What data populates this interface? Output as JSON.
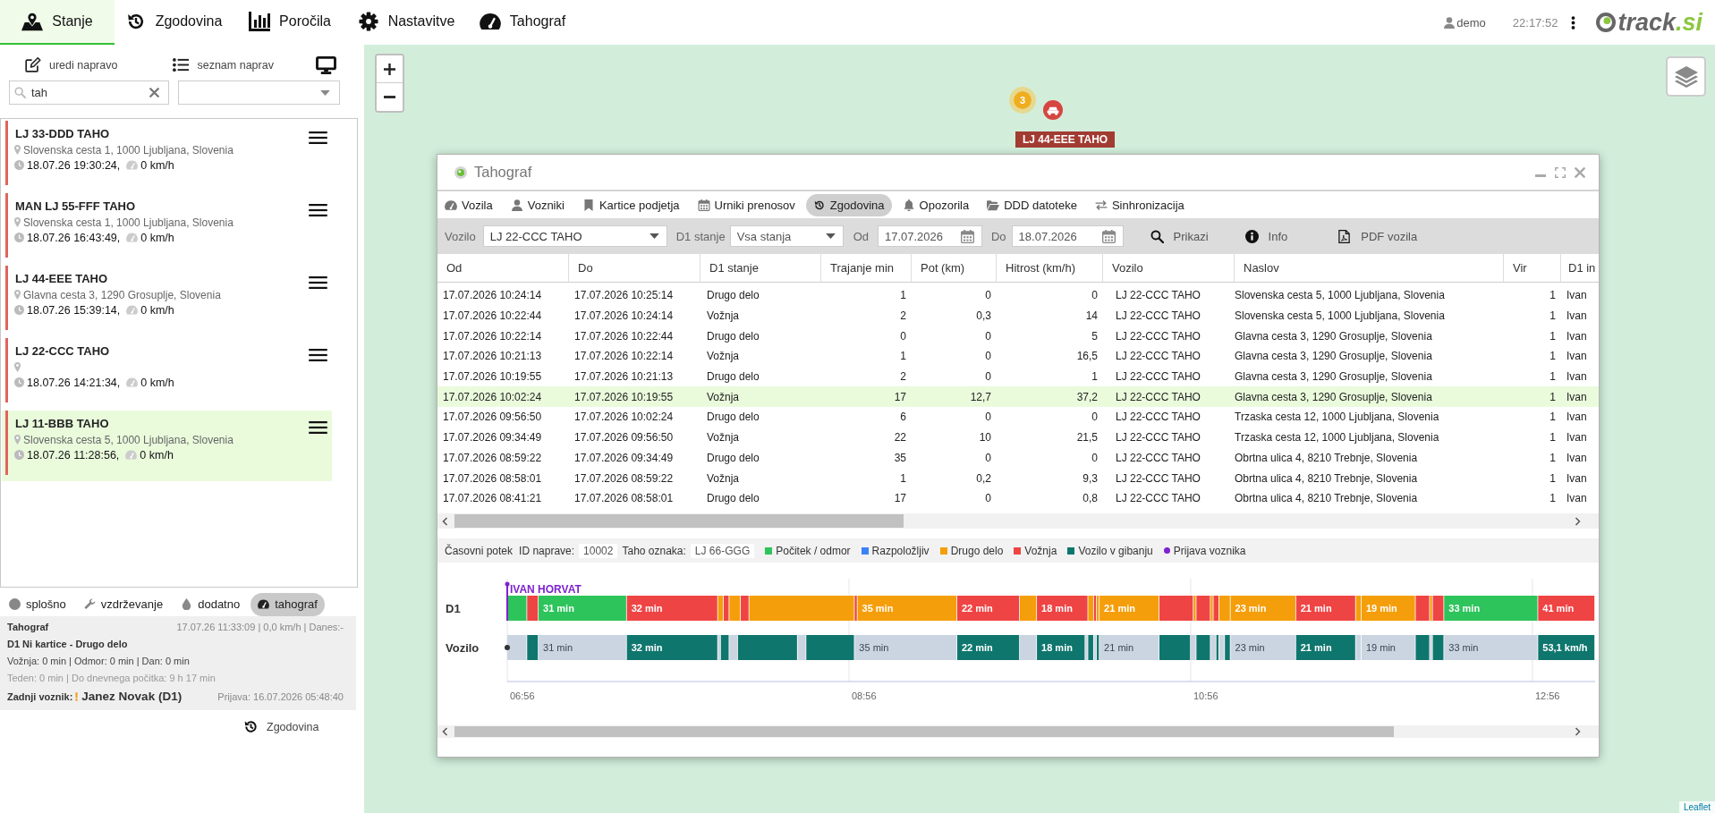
{
  "nav": {
    "tabs": [
      {
        "label": "Stanje",
        "selected": true
      },
      {
        "label": "Zgodovina",
        "selected": false
      },
      {
        "label": "Poročila",
        "selected": false
      },
      {
        "label": "Nastavitve",
        "selected": false
      },
      {
        "label": "Tahograf",
        "selected": false
      }
    ]
  },
  "header": {
    "user": "demo",
    "time": "22:17:52",
    "logo": {
      "text": "track",
      "suffix": ".si"
    }
  },
  "device_panel": {
    "toolbar": [
      "uredi napravo",
      "seznam naprav"
    ],
    "search": {
      "value": "tah"
    },
    "devices": [
      {
        "name": "LJ 33-DDD TAHO",
        "address": "Slovenska cesta 1, 1000 Ljubljana, Slovenia",
        "time": "18.07.26 19:30:24,",
        "speed": "0 km/h",
        "color": "#e0645c",
        "selected": false
      },
      {
        "name": "MAN LJ 55-FFF TAHO",
        "address": "Slovenska cesta 1, 1000 Ljubljana, Slovenia",
        "time": "18.07.26 16:43:49,",
        "speed": "0 km/h",
        "color": "#e0645c",
        "selected": false
      },
      {
        "name": "LJ 44-EEE TAHO",
        "address": "Glavna cesta 3, 1290 Grosuplje, Slovenia",
        "time": "18.07.26 15:39:14,",
        "speed": "0 km/h",
        "color": "#e0645c",
        "selected": false
      },
      {
        "name": "LJ 22-CCC TAHO",
        "time": "18.07.26 14:21:34,",
        "speed": "0 km/h",
        "color": "#e0645c",
        "selected": false
      },
      {
        "name": "LJ 11-BBB TAHO",
        "address": "Slovenska cesta 5, 1000 Ljubljana, Slovenia",
        "time": "18.07.26 11:28:56,",
        "speed": "0 km/h",
        "color": "#e0645c",
        "selected": true
      }
    ],
    "detail_tabs": [
      {
        "label": "splošno",
        "selected": false
      },
      {
        "label": "vzdrževanje",
        "selected": false
      },
      {
        "label": "dodatno",
        "selected": false
      },
      {
        "label": "tahograf",
        "selected": true
      }
    ],
    "tachograph": {
      "title": "Tahograf",
      "status": "17.07.26 11:33:09 | 0,0 km/h | Danes:-",
      "card": "D1 Ni kartice - Drugo delo",
      "driving": "Vožnja: 0 min | Odmor: 0 min | Dan: 0 min",
      "week": "Teden: 0 min | Do dnevnega počitka: 9 h 17 min",
      "last_driver_label": "Zadnji voznik:",
      "last_driver": "Janez Novak (D1)",
      "login": "Prijava: 16.07.2026 05:48:40"
    },
    "history_link": "Zgodovina"
  },
  "map": {
    "cluster_count": "3",
    "vehicle_label": "LJ 44-EEE TAHO",
    "attribution": "Leaflet"
  },
  "dialog": {
    "title": "Tahograf",
    "tabs": [
      {
        "label": "Vozila",
        "selected": false
      },
      {
        "label": "Vozniki",
        "selected": false
      },
      {
        "label": "Kartice podjetja",
        "selected": false
      },
      {
        "label": "Urniki prenosov",
        "selected": false
      },
      {
        "label": "Zgodovina",
        "selected": true
      },
      {
        "label": "Opozorila",
        "selected": false
      },
      {
        "label": "DDD datoteke",
        "selected": false
      },
      {
        "label": "Sinhronizacija",
        "selected": false
      }
    ],
    "filters": {
      "vehicle_label": "Vozilo",
      "vehicle": "LJ 22-CCC TAHO",
      "state_label": "D1 stanje",
      "state": "Vsa stanja",
      "from_label": "Od",
      "from": "17.07.2026",
      "to_label": "Do",
      "to": "18.07.2026"
    },
    "actions": [
      "Prikazi",
      "Info",
      "PDF vozila"
    ],
    "table": {
      "columns": [
        "Od",
        "Do",
        "D1 stanje",
        "Trajanje min",
        "Pot (km)",
        "Hitrost (km/h)",
        "Vozilo",
        "Naslov",
        "Vir",
        "D1 in"
      ],
      "rows": [
        {
          "cells": [
            "17.07.2026 10:24:14",
            "17.07.2026 10:25:14",
            "Drugo delo",
            "1",
            "0",
            "0",
            "LJ 22-CCC TAHO",
            "Slovenska cesta 5, 1000 Ljubljana, Slovenia",
            "1",
            "Ivan"
          ],
          "selected": false
        },
        {
          "cells": [
            "17.07.2026 10:22:44",
            "17.07.2026 10:24:14",
            "Vožnja",
            "2",
            "0,3",
            "14",
            "LJ 22-CCC TAHO",
            "Slovenska cesta 5, 1000 Ljubljana, Slovenia",
            "1",
            "Ivan"
          ],
          "selected": false
        },
        {
          "cells": [
            "17.07.2026 10:22:14",
            "17.07.2026 10:22:44",
            "Drugo delo",
            "0",
            "0",
            "5",
            "LJ 22-CCC TAHO",
            "Glavna cesta 3, 1290 Grosuplje, Slovenia",
            "1",
            "Ivan"
          ],
          "selected": false
        },
        {
          "cells": [
            "17.07.2026 10:21:13",
            "17.07.2026 10:22:14",
            "Vožnja",
            "1",
            "0",
            "16,5",
            "LJ 22-CCC TAHO",
            "Glavna cesta 3, 1290 Grosuplje, Slovenia",
            "1",
            "Ivan"
          ],
          "selected": false
        },
        {
          "cells": [
            "17.07.2026 10:19:55",
            "17.07.2026 10:21:13",
            "Drugo delo",
            "2",
            "0",
            "1",
            "LJ 22-CCC TAHO",
            "Glavna cesta 3, 1290 Grosuplje, Slovenia",
            "1",
            "Ivan"
          ],
          "selected": false
        },
        {
          "cells": [
            "17.07.2026 10:02:24",
            "17.07.2026 10:19:55",
            "Vožnja",
            "17",
            "12,7",
            "37,2",
            "LJ 22-CCC TAHO",
            "Glavna cesta 3, 1290 Grosuplje, Slovenia",
            "1",
            "Ivan"
          ],
          "selected": true
        },
        {
          "cells": [
            "17.07.2026 09:56:50",
            "17.07.2026 10:02:24",
            "Drugo delo",
            "6",
            "0",
            "0",
            "LJ 22-CCC TAHO",
            "Trzaska cesta 12, 1000 Ljubljana, Slovenia",
            "1",
            "Ivan"
          ],
          "selected": false
        },
        {
          "cells": [
            "17.07.2026 09:34:49",
            "17.07.2026 09:56:50",
            "Vožnja",
            "22",
            "10",
            "21,5",
            "LJ 22-CCC TAHO",
            "Trzaska cesta 12, 1000 Ljubljana, Slovenia",
            "1",
            "Ivan"
          ],
          "selected": false
        },
        {
          "cells": [
            "17.07.2026 08:59:22",
            "17.07.2026 09:34:49",
            "Drugo delo",
            "35",
            "0",
            "0",
            "LJ 22-CCC TAHO",
            "Obrtna ulica 4, 8210 Trebnje, Slovenia",
            "1",
            "Ivan"
          ],
          "selected": false
        },
        {
          "cells": [
            "17.07.2026 08:58:01",
            "17.07.2026 08:59:22",
            "Vožnja",
            "1",
            "0,2",
            "9,3",
            "LJ 22-CCC TAHO",
            "Obrtna ulica 4, 8210 Trebnje, Slovenia",
            "1",
            "Ivan"
          ],
          "selected": false
        },
        {
          "cells": [
            "17.07.2026 08:41:21",
            "17.07.2026 08:58:01",
            "Drugo delo",
            "17",
            "0",
            "0,8",
            "LJ 22-CCC TAHO",
            "Obrtna ulica 4, 8210 Trebnje, Slovenia",
            "1",
            "Ivan"
          ],
          "selected": false
        }
      ]
    },
    "timeline": {
      "title": "Časovni potek",
      "device_id_label": "ID naprave:",
      "device_id": "10002",
      "taho_label": "Taho oznaka:",
      "taho": "LJ 66-GGG",
      "legend": [
        {
          "kind": "rest",
          "label": "Počitek / odmor",
          "color": "#2ec45c"
        },
        {
          "kind": "available",
          "label": "Razpoložljiv",
          "color": "#3b82f6"
        },
        {
          "kind": "work",
          "label": "Drugo delo",
          "color": "#f59e0b"
        },
        {
          "kind": "driving",
          "label": "Vožnja",
          "color": "#ef4444"
        },
        {
          "kind": "moving",
          "label": "Vozilo v gibanju",
          "color": "#0f766e"
        },
        {
          "kind": "login",
          "label": "Prijava voznika",
          "color": "#7e22ce"
        }
      ],
      "driver_login": "IVAN HORVAT",
      "rows": [
        {
          "label": "D1",
          "segment_labels": [
            "31 min",
            "32 min",
            "35 min",
            "22 min",
            "18 min",
            "21 min",
            "23 min",
            "21 min",
            "19 min",
            "33 min",
            "41 min"
          ]
        },
        {
          "label": "Vozilo",
          "segment_labels": [
            "31 min",
            "32 min",
            "35 min",
            "22 min",
            "18 min",
            "21 min",
            "23 min",
            "21 min",
            "19 min",
            "33 min",
            "53,1 km/h"
          ]
        }
      ],
      "axis_labels": [
        "06:56",
        "08:56",
        "10:56",
        "12:56"
      ]
    }
  }
}
